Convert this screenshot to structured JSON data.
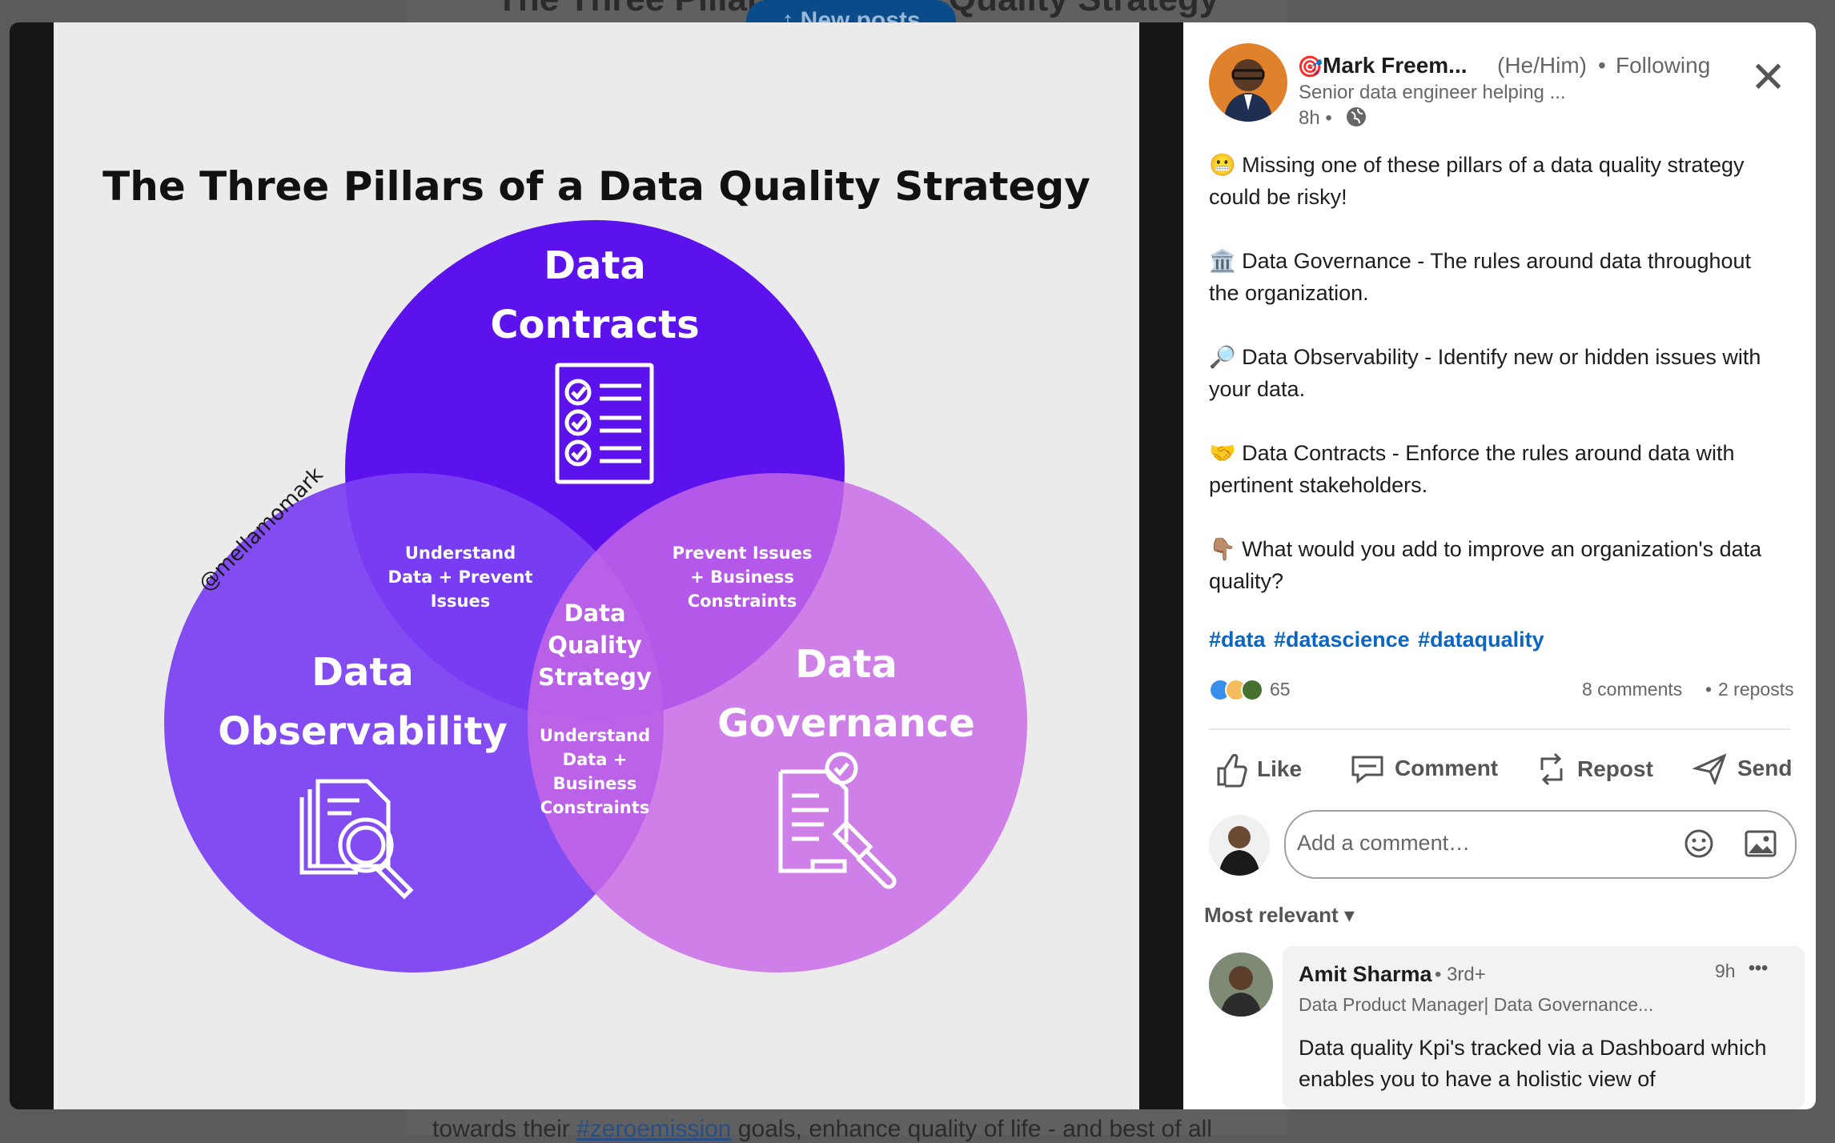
{
  "background": {
    "headline": "The Three Pillars of a Data Quality Strategy",
    "new_posts_label": "↑ New posts",
    "partial_text_before": "towards their ",
    "partial_tag": "#zeroemission",
    "partial_text_after": " goals, enhance quality of life - and best of all"
  },
  "infographic": {
    "title": "The Three Pillars of a Data Quality Strategy",
    "watermark": "@mellamomark",
    "top_circle": {
      "line1": "Data",
      "line2": "Contracts",
      "icon": "checklist-icon"
    },
    "left_circle": {
      "line1": "Data",
      "line2": "Observability",
      "icon": "document-magnifier-icon"
    },
    "right_circle": {
      "line1": "Data",
      "line2": "Governance",
      "icon": "document-gavel-icon"
    },
    "overlap_left": [
      "Understand",
      "Data + Prevent",
      "Issues"
    ],
    "overlap_right": [
      "Prevent Issues",
      "+ Business",
      "Constraints"
    ],
    "overlap_bottom": [
      "Understand",
      "Data +",
      "Business",
      "Constraints"
    ],
    "center": [
      "Data",
      "Quality",
      "Strategy"
    ],
    "colors": {
      "top": "#5b12ec",
      "left": "#7b3ff2",
      "right": "#c768e6",
      "background": "#ebebeb"
    }
  },
  "post": {
    "author": {
      "badge_icon": "target-icon",
      "name": "Mark Freem...",
      "pronouns": "(He/Him)",
      "separator": "•",
      "follow_status": "Following",
      "headline": "Senior data engineer helping ...",
      "time": "8h",
      "visibility_icon": "globe-icon"
    },
    "paragraphs": [
      {
        "emoji": "😬",
        "text": "Missing one of these pillars of a data quality strategy could be risky!"
      },
      {
        "emoji": "🏛️",
        "text": "Data Governance - The rules around data throughout the organization."
      },
      {
        "emoji": "🔎",
        "text": "Data Observability - Identify new or hidden issues with your data."
      },
      {
        "emoji": "🤝",
        "text": "Data Contracts - Enforce the rules around data with pertinent stakeholders."
      },
      {
        "emoji": "👇🏽",
        "text": "What would you add to improve an organization's data quality?"
      }
    ],
    "hashtags": [
      "#data",
      "#datascience",
      "#dataquality"
    ],
    "reactions_count": "65",
    "comments_count": "8 comments",
    "dot": "•",
    "reposts_count": "2 reposts",
    "actions": [
      {
        "label": "Like",
        "icon": "thumbs-up-icon"
      },
      {
        "label": "Comment",
        "icon": "comment-icon"
      },
      {
        "label": "Repost",
        "icon": "repost-icon"
      },
      {
        "label": "Send",
        "icon": "send-icon"
      }
    ],
    "comment_placeholder": "Add a comment…",
    "sort_label": "Most relevant ▾"
  },
  "comments": [
    {
      "name": "Amit Sharma",
      "degree": "• 3rd+",
      "headline": "Data Product Manager| Data Governance...",
      "time": "9h",
      "more": "•••",
      "text": "Data quality Kpi's tracked via a Dashboard which enables you to have a holistic view of"
    }
  ]
}
